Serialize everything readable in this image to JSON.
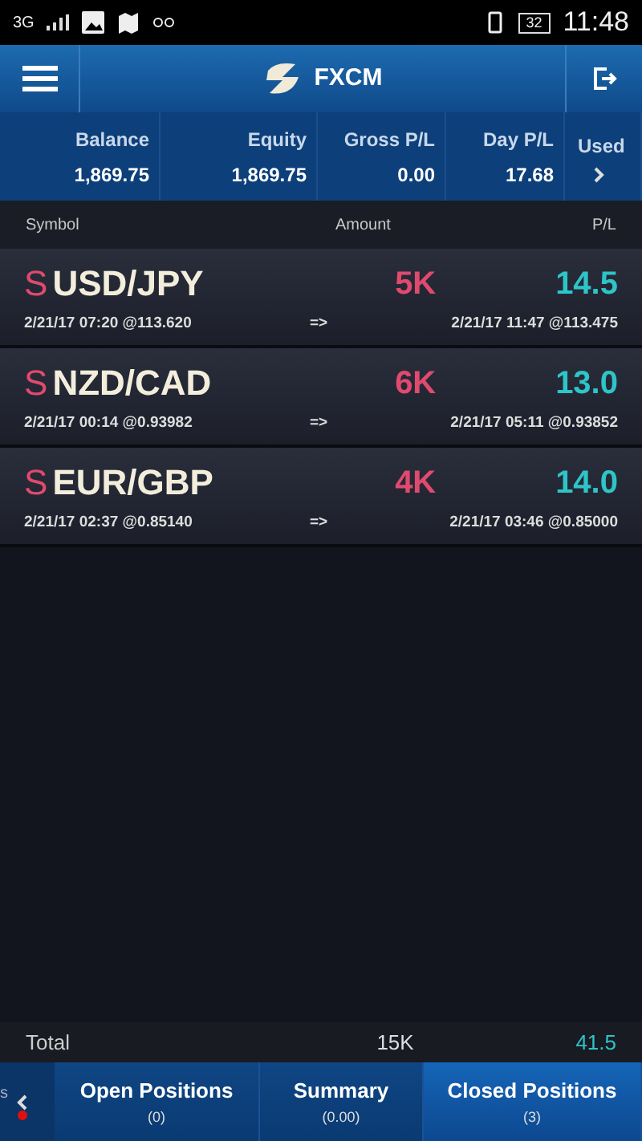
{
  "status_bar": {
    "network": "3G",
    "battery": "32",
    "time": "11:48"
  },
  "header": {
    "title": "FXCM"
  },
  "summary": [
    {
      "label": "Balance",
      "value": "1,869.75"
    },
    {
      "label": "Equity",
      "value": "1,869.75"
    },
    {
      "label": "Gross P/L",
      "value": "0.00"
    },
    {
      "label": "Day P/L",
      "value": "17.68"
    },
    {
      "label": "Used"
    }
  ],
  "columns": [
    "Symbol",
    "Amount",
    "P/L"
  ],
  "rows": [
    {
      "side": "S",
      "symbol": "USD/JPY",
      "amount": "5K",
      "pl": "14.5",
      "open": "2/21/17 07:20 @113.620",
      "arrow": "=>",
      "close": "2/21/17 11:47 @113.475"
    },
    {
      "side": "S",
      "symbol": "NZD/CAD",
      "amount": "6K",
      "pl": "13.0",
      "open": "2/21/17 00:14 @0.93982",
      "arrow": "=>",
      "close": "2/21/17 05:11 @0.93852"
    },
    {
      "side": "S",
      "symbol": "EUR/GBP",
      "amount": "4K",
      "pl": "14.0",
      "open": "2/21/17 02:37 @0.85140",
      "arrow": "=>",
      "close": "2/21/17 03:46 @0.85000"
    }
  ],
  "total": {
    "label": "Total",
    "amount": "15K",
    "pl": "41.5"
  },
  "tabs_partial": "s",
  "tabs": [
    {
      "label": "Open Positions",
      "count": "(0)",
      "selected": false
    },
    {
      "label": "Summary",
      "count": "(0.00)",
      "selected": false
    },
    {
      "label": "Closed Positions",
      "count": "(3)",
      "selected": true
    }
  ]
}
